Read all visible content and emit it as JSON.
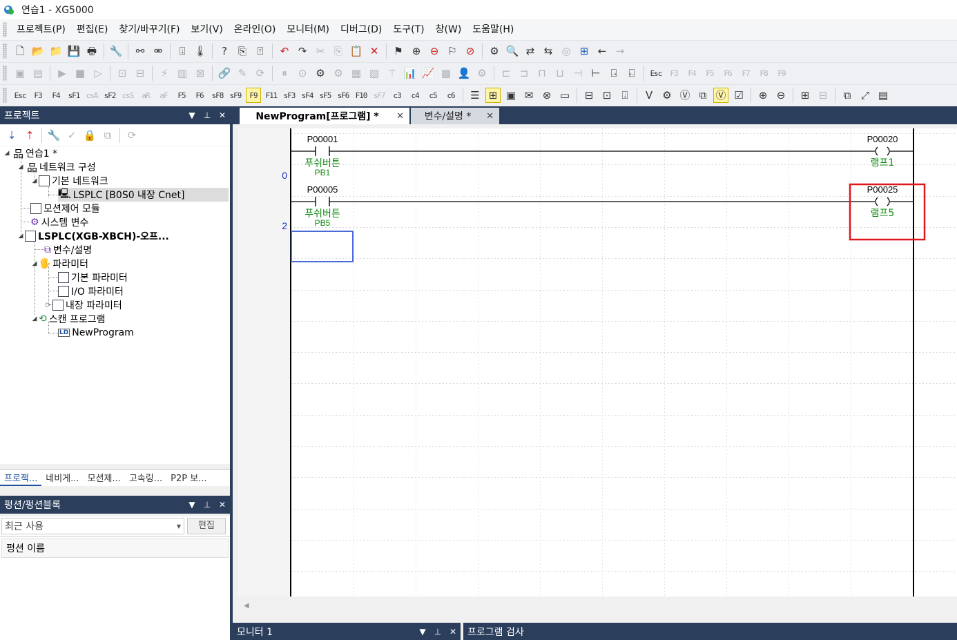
{
  "window": {
    "title": "연습1 - XG5000"
  },
  "menu": [
    "프로젝트(P)",
    "편집(E)",
    "찾기/바꾸기(F)",
    "보기(V)",
    "온라인(O)",
    "모니터(M)",
    "디버그(D)",
    "도구(T)",
    "창(W)",
    "도움말(H)"
  ],
  "toolbar_fkeys": [
    {
      "top": "Esc",
      "bot": ""
    },
    {
      "top": "F3",
      "bot": ""
    },
    {
      "top": "F4",
      "bot": ""
    },
    {
      "top": "sF1",
      "bot": ""
    },
    {
      "top": "csA",
      "bot": ""
    },
    {
      "top": "sF2",
      "bot": ""
    },
    {
      "top": "csS",
      "bot": ""
    },
    {
      "top": "aR",
      "bot": ""
    },
    {
      "top": "aF",
      "bot": ""
    },
    {
      "top": "F5",
      "bot": ""
    },
    {
      "top": "F6",
      "bot": ""
    },
    {
      "top": "sF8",
      "bot": ""
    },
    {
      "top": "sF9",
      "bot": ""
    },
    {
      "top": "F9",
      "bot": ""
    },
    {
      "top": "F11",
      "bot": ""
    },
    {
      "top": "sF3",
      "bot": ""
    },
    {
      "top": "sF4",
      "bot": ""
    },
    {
      "top": "sF5",
      "bot": ""
    },
    {
      "top": "sF6",
      "bot": ""
    },
    {
      "top": "F10",
      "bot": ""
    },
    {
      "top": "sF7",
      "bot": ""
    },
    {
      "top": "c3",
      "bot": ""
    },
    {
      "top": "c4",
      "bot": ""
    },
    {
      "top": "c5",
      "bot": ""
    },
    {
      "top": "c6",
      "bot": ""
    }
  ],
  "toolbar_row2_fkeys": [
    "Esc",
    "F3",
    "F4",
    "F5",
    "F6",
    "F7",
    "F8",
    "F9"
  ],
  "project_panel": {
    "title": "프로젝트",
    "tree": [
      {
        "label": "연습1 *",
        "depth": 0,
        "exp": "◢"
      },
      {
        "label": "네트워크 구성",
        "depth": 1,
        "exp": "◢"
      },
      {
        "label": "기본 네트워크",
        "depth": 2,
        "exp": "◢"
      },
      {
        "label": "LSPLC [B0S0 내장 Cnet]",
        "depth": 3,
        "exp": ""
      },
      {
        "label": "모션제어 모듈",
        "depth": 1,
        "exp": ""
      },
      {
        "label": "시스템 변수",
        "depth": 1,
        "exp": ""
      },
      {
        "label": "LSPLC(XGB-XBCH)-오프...",
        "depth": 1,
        "exp": "◢"
      },
      {
        "label": "변수/설명",
        "depth": 2,
        "exp": ""
      },
      {
        "label": "파라미터",
        "depth": 2,
        "exp": "◢"
      },
      {
        "label": "기본 파라미터",
        "depth": 3,
        "exp": ""
      },
      {
        "label": "I/O 파라미터",
        "depth": 3,
        "exp": ""
      },
      {
        "label": "내장 파라미터",
        "depth": 3,
        "exp": "▷"
      },
      {
        "label": "스캔 프로그램",
        "depth": 2,
        "exp": "◢"
      },
      {
        "label": "NewProgram",
        "depth": 3,
        "exp": ""
      }
    ],
    "tabs": [
      "프로젝...",
      "네비게...",
      "모션제...",
      "고속링...",
      "P2P 보..."
    ]
  },
  "function_panel": {
    "title": "펑션/펑션블록",
    "search_value": "최근 사용",
    "edit_label": "편집",
    "column_header": "펑션 이름"
  },
  "editor": {
    "tabs": [
      {
        "label": "NewProgram[프로그램] *",
        "active": true
      },
      {
        "label": "변수/설명 *",
        "active": false
      }
    ],
    "rungs": [
      {
        "step": "0",
        "contact_addr": "P00001",
        "contact_comment": "푸쉬버튼",
        "contact_var": "PB1",
        "coil_addr": "P00020",
        "coil_var": "램프1",
        "highlighted": false
      },
      {
        "step": "2",
        "contact_addr": "P00005",
        "contact_comment": "푸쉬버튼",
        "contact_var": "PB5",
        "coil_addr": "P00025",
        "coil_var": "램프5",
        "highlighted": true
      }
    ],
    "highlight_color": "#e0161b",
    "comment_color": "#118a11",
    "step_color": "#1030c0"
  },
  "bottom": {
    "monitor_title": "모니터 1",
    "check_title": "프로그램 검사"
  }
}
